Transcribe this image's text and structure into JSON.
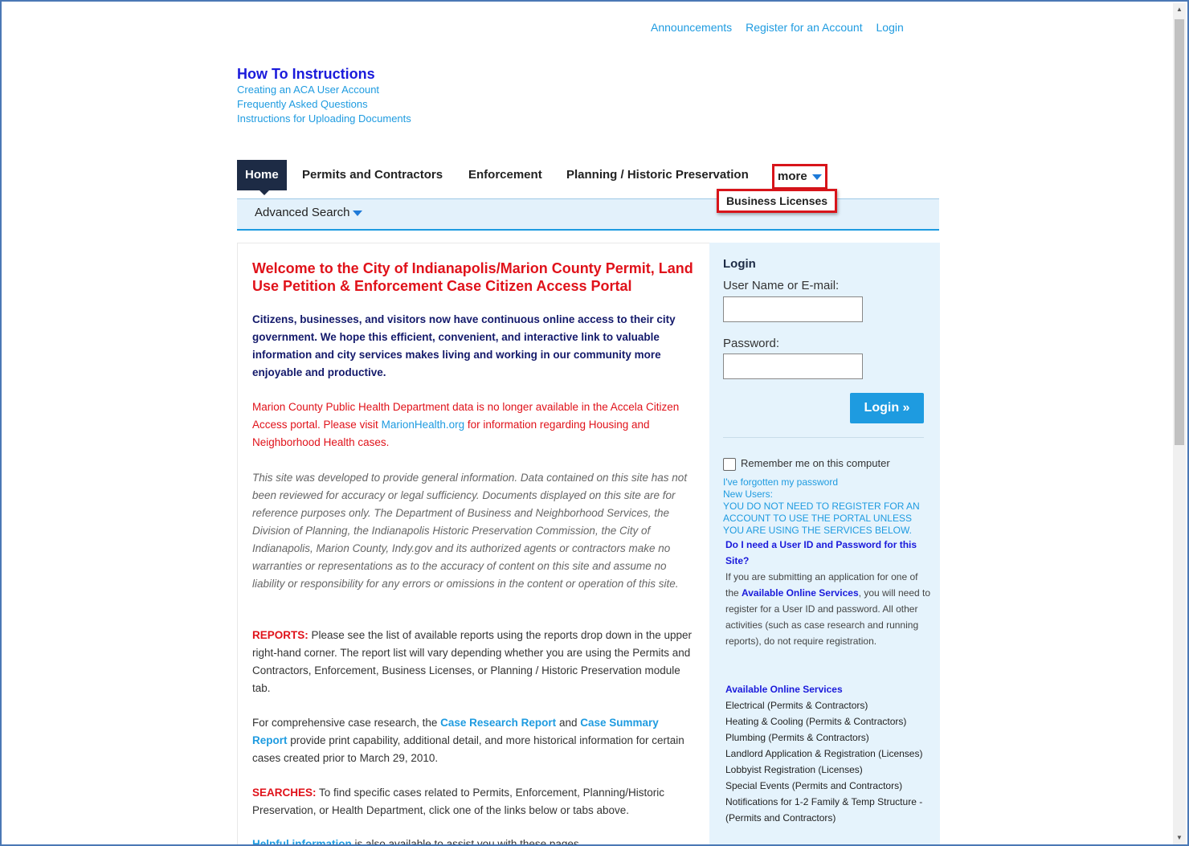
{
  "top_links": [
    "Announcements",
    "Register for an Account",
    "Login"
  ],
  "howto": {
    "title": "How To Instructions",
    "links": [
      "Creating an ACA User Account",
      "Frequently Asked Questions",
      "Instructions for Uploading Documents"
    ]
  },
  "nav": {
    "home": "Home",
    "permits": "Permits and Contractors",
    "enforcement": "Enforcement",
    "planning": "Planning / Historic Preservation",
    "more": "more",
    "dropdown_item": "Business Licenses",
    "advanced_search": "Advanced Search"
  },
  "main": {
    "welcome": "Welcome to the City of Indianapolis/Marion County Permit, Land Use Petition & Enforcement Case Citizen Access Portal",
    "intro": "Citizens, businesses, and visitors now have continuous online access to their city government.  We hope this efficient, convenient, and interactive link to valuable information and city services makes living and working in our community more enjoyable and productive.",
    "health_a": "Marion County Public Health Department data is no longer available in the Accela Citizen Access portal. Please visit ",
    "health_link": "MarionHealth.org",
    "health_b": " for information regarding Housing and Neighborhood Health cases.",
    "disclaimer": "This site was developed to provide general information. Data contained on this site has not been reviewed for accuracy or legal sufficiency. Documents displayed on this site are for reference purposes only. The Department of Business and Neighborhood Services, the Division of Planning, the Indianapolis Historic Preservation Commission, the City of Indianapolis, Marion County, Indy.gov and its authorized agents or contractors make no warranties or representations as to the accuracy of content on this site and assume no liability or responsibility for any errors or omissions in the content or operation of this site.",
    "reports_label": "REPORTS:",
    "reports_text": " Please see the list of available reports using the reports drop down in the upper right-hand corner. The report list will vary depending whether you are using the Permits and Contractors, Enforcement, Business Licenses, or Planning / Historic Preservation module tab.",
    "research_a": "For comprehensive case research, the ",
    "research_link1": "Case Research Report",
    "research_and": " and ",
    "research_link2": "Case Summary Report",
    "research_b": " provide print capability, additional detail, and more historical information for certain cases created prior to March 29, 2010.",
    "searches_label": "SEARCHES:",
    "searches_text": " To find specific cases related to Permits, Enforcement, Planning/Historic Preservation, or Health Department, click one of the links below or tabs above.",
    "helpful_link": "Helpful information",
    "helpful_text": " is also available to assist you with these pages."
  },
  "login": {
    "title": "Login",
    "username_label": "User Name or E-mail:",
    "username_value": "",
    "password_label": "Password:",
    "password_value": "",
    "button": "Login »",
    "remember": "Remember me on this computer",
    "forgot": "I've forgotten my password",
    "new_users": "New Users:",
    "notice": "YOU DO NOT NEED TO REGISTER FOR AN ACCOUNT TO USE THE PORTAL UNLESS YOU ARE USING THE SERVICES BELOW.",
    "question": "Do I need a User ID and Password for this Site?",
    "answer_a": "If you are submitting an application for one of the ",
    "answer_link": "Available Online Services",
    "answer_b": ", you will need to register for a User ID and password. All other activities (such as case research and running reports), do not require registration.",
    "services_title": "Available Online Services",
    "services": [
      "Electrical (Permits & Contractors)",
      "Heating & Cooling (Permits & Contractors)",
      "Plumbing (Permits & Contractors)",
      "Landlord Application & Registration (Licenses)",
      "Lobbyist Registration (Licenses)",
      "Special Events (Permits and Contractors)",
      "Notifications for 1-2 Family & Temp Structure - (Permits and Contractors)"
    ]
  },
  "colors": {
    "accent": "#1e9be0",
    "nav_active": "#1d2b45",
    "alert": "#e0121a",
    "highlight_border": "#d8141a"
  }
}
